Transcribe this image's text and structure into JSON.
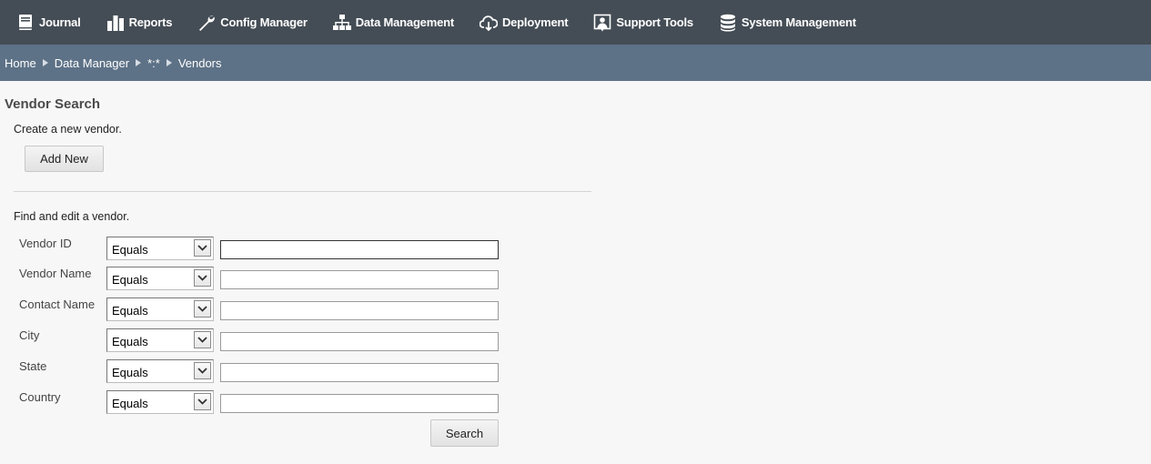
{
  "nav": {
    "items": [
      {
        "label": "Journal",
        "icon": "book-icon"
      },
      {
        "label": "Reports",
        "icon": "bar-chart-icon"
      },
      {
        "label": "Config Manager",
        "icon": "wrench-icon"
      },
      {
        "label": "Data Management",
        "icon": "hierarchy-icon"
      },
      {
        "label": "Deployment",
        "icon": "cloud-download-icon"
      },
      {
        "label": "Support Tools",
        "icon": "support-person-icon"
      },
      {
        "label": "System Management",
        "icon": "database-icon"
      }
    ]
  },
  "breadcrumb": {
    "items": [
      "Home",
      "Data Manager",
      "*:*",
      "Vendors"
    ]
  },
  "main": {
    "title": "Vendor Search",
    "create_label": "Create a new vendor.",
    "add_new_label": "Add New",
    "find_label": "Find and edit a vendor.",
    "search_label": "Search",
    "fields": [
      {
        "label": "Vendor ID",
        "operator": "Equals",
        "value": ""
      },
      {
        "label": "Vendor Name",
        "operator": "Equals",
        "value": ""
      },
      {
        "label": "Contact Name",
        "operator": "Equals",
        "value": ""
      },
      {
        "label": "City",
        "operator": "Equals",
        "value": ""
      },
      {
        "label": "State",
        "operator": "Equals",
        "value": ""
      },
      {
        "label": "Country",
        "operator": "Equals",
        "value": ""
      }
    ]
  },
  "colors": {
    "topnav_bg": "#444d55",
    "breadcrumb_bg": "#5e7287",
    "page_bg": "#f7f7f7"
  }
}
